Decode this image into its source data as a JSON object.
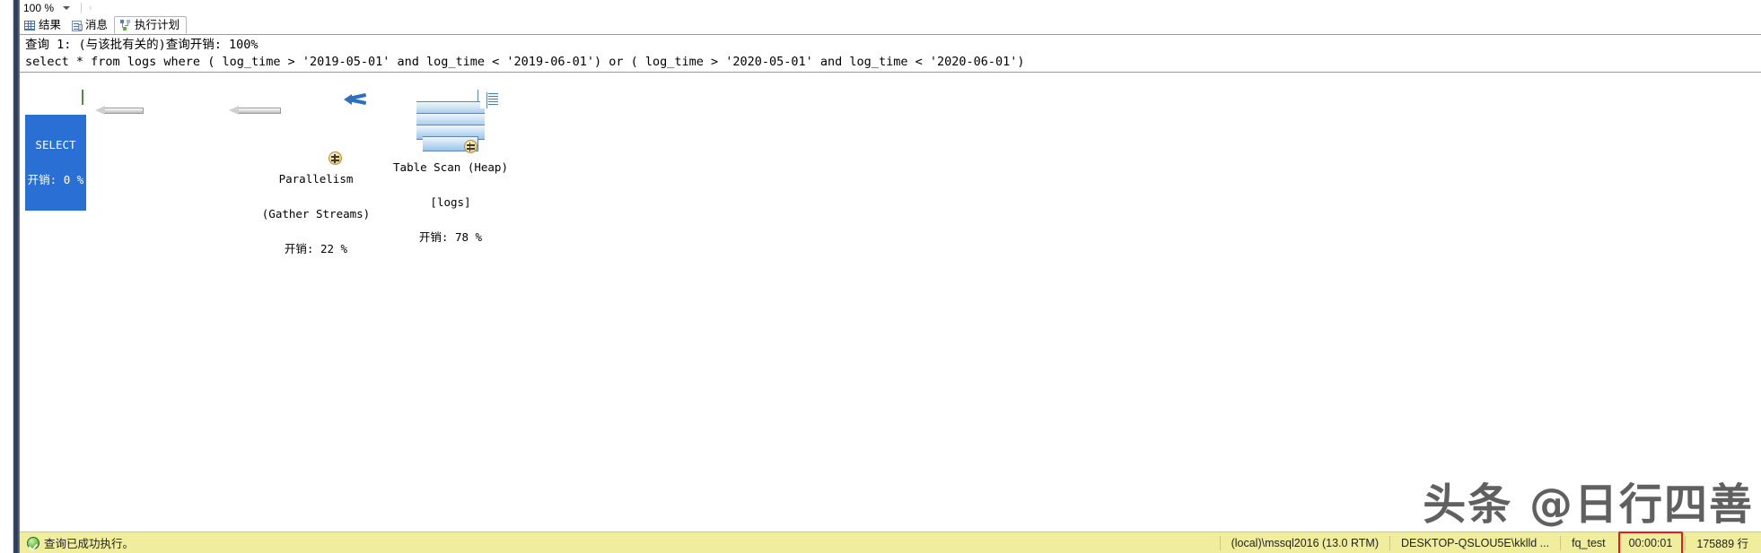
{
  "window": {
    "zoom_level": "100 %"
  },
  "tabs": [
    {
      "id": "results",
      "label": "结果",
      "icon": "grid-icon",
      "active": false
    },
    {
      "id": "messages",
      "label": "消息",
      "icon": "message-icon",
      "active": false
    },
    {
      "id": "execution-plan",
      "label": "执行计划",
      "icon": "plan-icon",
      "active": true
    }
  ],
  "plan": {
    "query_cost_line": "查询 1: (与该批有关的)查询开销: 100%",
    "sql": "select * from logs where ( log_time > '2019-05-01' and log_time < '2019-06-01') or ( log_time > '2020-05-01' and log_time < '2020-06-01')",
    "nodes": [
      {
        "id": "select",
        "title": "SELECT",
        "subtitle": "",
        "cost": "开销: 0 %",
        "icon": "select-result-icon",
        "selected": true
      },
      {
        "id": "parallelism",
        "title": "Parallelism",
        "subtitle": "(Gather Streams)",
        "cost": "开销: 22 %",
        "icon": "parallelism-icon",
        "selected": false
      },
      {
        "id": "table-scan",
        "title": "Table Scan (Heap)",
        "subtitle": "[logs]",
        "cost": "开销: 78 %",
        "icon": "table-scan-icon",
        "selected": false
      }
    ]
  },
  "watermark": {
    "text": "头条 @日行四善"
  },
  "status": {
    "message": "查询已成功执行。",
    "server": "(local)\\mssql2016 (13.0 RTM)",
    "user": "DESKTOP-QSLOU5E\\kklld ...",
    "database": "fq_test",
    "elapsed": "00:00:01",
    "rows": "175889 行"
  },
  "colors": {
    "status_bar": "#f0ee9c",
    "selection": "#2a6fd4",
    "highlight_box": "#e01b1b",
    "gutter": "#2c3e63"
  }
}
